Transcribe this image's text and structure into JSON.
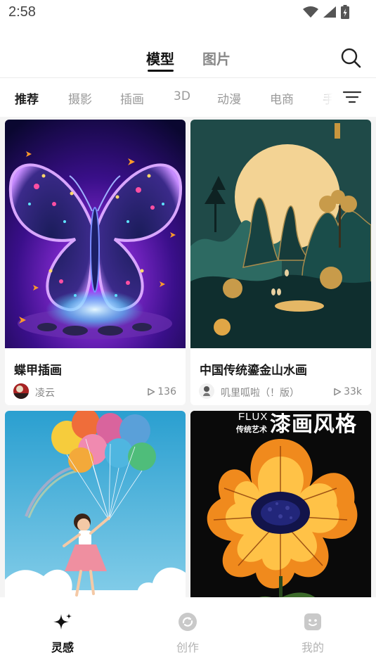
{
  "status_bar": {
    "time": "2:58"
  },
  "top_tabs": [
    {
      "label": "模型",
      "active": true
    },
    {
      "label": "图片",
      "active": false
    }
  ],
  "categories": [
    "推荐",
    "摄影",
    "插画",
    "3D",
    "动漫",
    "电商",
    "手"
  ],
  "feed": {
    "cards": [
      {
        "title": "蝶甲插画",
        "author": "凌云",
        "plays": "136"
      },
      {
        "title": "中国传统鎏金山水画",
        "author": "叽里呱啦（！版）",
        "plays": "33k"
      },
      {
        "title": "",
        "author": "",
        "plays": ""
      },
      {
        "title": "",
        "author": "",
        "plays": "",
        "overlay_tag": "FLUX",
        "overlay_sub": "传统艺术",
        "overlay_title": "漆画风格"
      }
    ]
  },
  "bottom_nav": [
    {
      "label": "灵感",
      "icon": "sparkle-icon",
      "active": true
    },
    {
      "label": "创作",
      "icon": "create-icon",
      "active": false
    },
    {
      "label": "我的",
      "icon": "profile-icon",
      "active": false
    }
  ],
  "colors": {
    "active_text": "#111111",
    "inactive_text": "#9a9a9a",
    "feed_bg": "#f4f4f4"
  }
}
